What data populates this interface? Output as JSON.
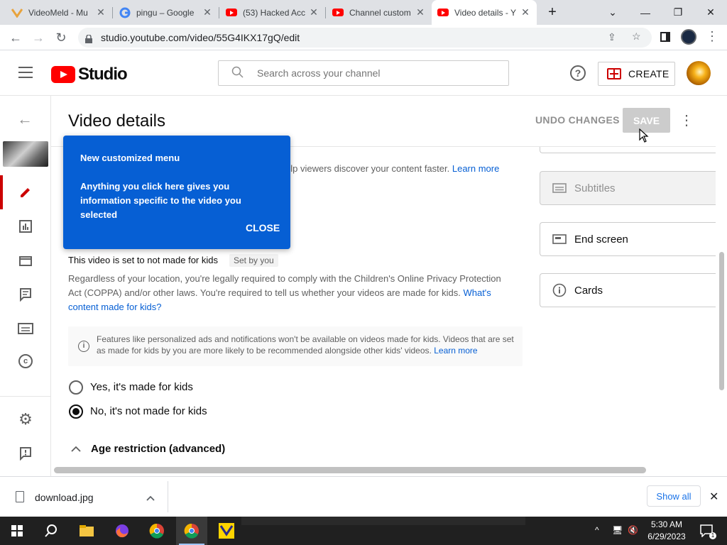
{
  "browser": {
    "tabs": [
      {
        "title": "VideoMeld - Mu"
      },
      {
        "title": "pingu – Google"
      },
      {
        "title": "(53) Hacked Acc"
      },
      {
        "title": "Channel custom"
      },
      {
        "title": "Video details - Y"
      }
    ],
    "url": "studio.youtube.com/video/55G4IKX17gQ/edit"
  },
  "studio": {
    "logo_text": "Studio",
    "search_placeholder": "Search across your channel",
    "create_label": "CREATE"
  },
  "page": {
    "title": "Video details",
    "undo_label": "UNDO CHANGES",
    "save_label": "SAVE"
  },
  "tooltip": {
    "title": "New customized menu",
    "body": "Anything you click here gives you information specific to the video you selected",
    "close_label": "CLOSE"
  },
  "main": {
    "partial_text": "elp viewers discover your content faster.",
    "partial_link": "Learn more",
    "kids_heading": "This video is set to not made for kids",
    "set_by_badge": "Set by you",
    "coppa_text": "Regardless of your location, you're legally required to comply with the Children's Online Privacy Protection Act (COPPA) and/or other laws. You're required to tell us whether your videos are made for kids.",
    "coppa_link": "What's content made for kids?",
    "info_text": "Features like personalized ads and notifications won't be available on videos made for kids. Videos that are set as made for kids by you are more likely to be recommended alongside other kids' videos.",
    "info_link": "Learn more",
    "radio_yes": "Yes, it's made for kids",
    "radio_no": "No, it's not made for kids",
    "selected": "no",
    "age_restriction": "Age restriction (advanced)"
  },
  "sidepanel": {
    "subtitles": "Subtitles",
    "end_screen": "End screen",
    "cards": "Cards"
  },
  "download": {
    "filename": "download.jpg",
    "show_all": "Show all"
  },
  "taskbar": {
    "time": "5:30 AM",
    "date": "6/29/2023"
  },
  "colors": {
    "accent_blue": "#065fd4",
    "yt_red": "#ff0000",
    "active_rail": "#cc0000"
  }
}
